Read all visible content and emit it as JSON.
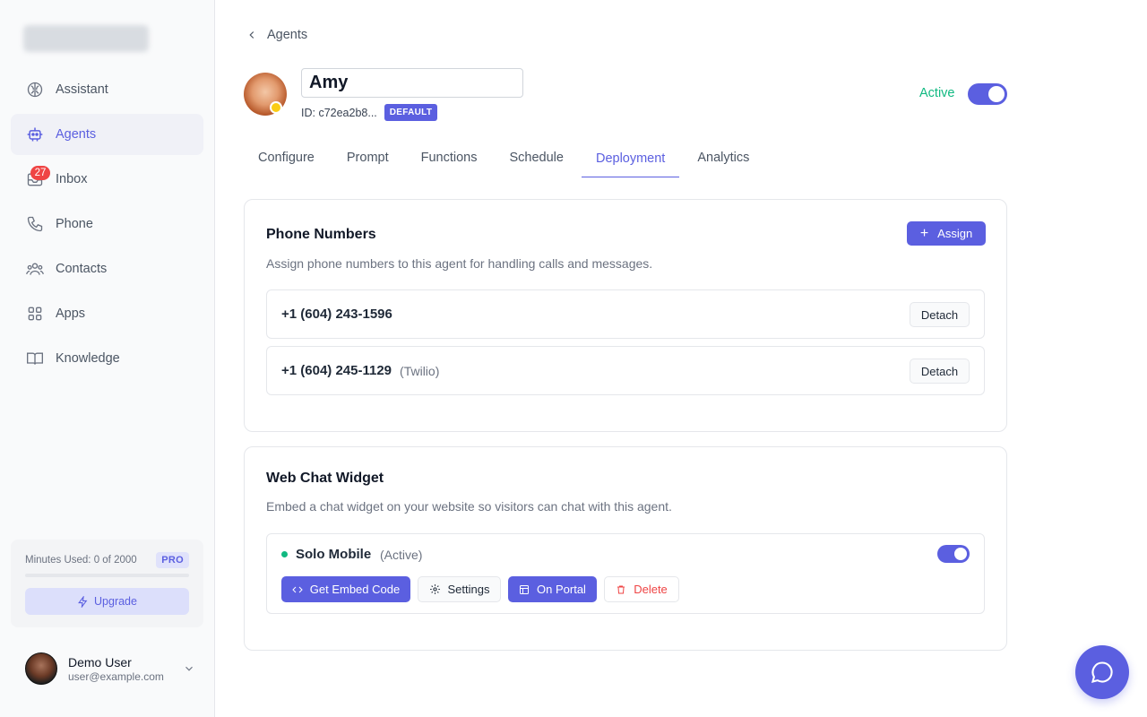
{
  "sidebar": {
    "items": [
      {
        "label": "Assistant",
        "icon": "brain-icon"
      },
      {
        "label": "Agents",
        "icon": "robot-icon"
      },
      {
        "label": "Inbox",
        "icon": "inbox-icon",
        "badge": "27"
      },
      {
        "label": "Phone",
        "icon": "phone-icon"
      },
      {
        "label": "Contacts",
        "icon": "users-icon"
      },
      {
        "label": "Apps",
        "icon": "grid-icon"
      },
      {
        "label": "Knowledge",
        "icon": "book-icon"
      }
    ],
    "active": "Agents",
    "usage": {
      "text": "Minutes Used: 0 of 2000",
      "plan": "PRO",
      "fraction": 0.0
    },
    "upgrade_label": "Upgrade",
    "user": {
      "name": "Demo User",
      "email": "user@example.com"
    }
  },
  "header": {
    "back_label": "Agents",
    "agent_name": "Amy",
    "agent_id": "ID: c72ea2b8...",
    "default_badge": "DEFAULT",
    "status_label": "Active",
    "status_on": true
  },
  "tabs": [
    {
      "label": "Configure"
    },
    {
      "label": "Prompt"
    },
    {
      "label": "Functions"
    },
    {
      "label": "Schedule"
    },
    {
      "label": "Deployment"
    },
    {
      "label": "Analytics"
    }
  ],
  "active_tab": "Deployment",
  "phone_numbers": {
    "title": "Phone Numbers",
    "subtitle": "Assign phone numbers to this agent for handling calls and messages.",
    "assign_label": "Assign",
    "items": [
      {
        "number": "+1 (604) 243-1596",
        "provider": "",
        "action": "Detach"
      },
      {
        "number": "+1 (604) 245-1129",
        "provider": "(Twilio)",
        "action": "Detach"
      }
    ]
  },
  "web_chat": {
    "title": "Web Chat Widget",
    "subtitle": "Embed a chat widget on your website so visitors can chat with this agent.",
    "widget": {
      "name": "Solo Mobile",
      "status": "(Active)",
      "enabled": true,
      "buttons": {
        "embed": "Get Embed Code",
        "settings": "Settings",
        "portal": "On Portal",
        "delete": "Delete"
      }
    }
  },
  "colors": {
    "accent": "#5b5fe0",
    "success": "#10b981",
    "danger": "#ef4444"
  }
}
